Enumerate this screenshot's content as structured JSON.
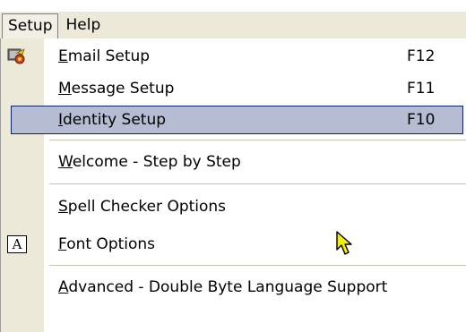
{
  "menubar": {
    "items": [
      {
        "label": "Setup"
      },
      {
        "label": "Help"
      }
    ]
  },
  "menu": {
    "items": [
      {
        "label": "Email Setup",
        "shortcut": "F12",
        "icon": "email-setup-icon"
      },
      {
        "label": "Message Setup",
        "shortcut": "F11"
      },
      {
        "label": "Identity Setup",
        "shortcut": "F10",
        "selected": true
      },
      {
        "label": "Welcome - Step by Step"
      },
      {
        "label": "Spell Checker Options"
      },
      {
        "label": "Font Options",
        "icon": "font-icon",
        "icon_text": "A"
      },
      {
        "label": "Advanced - Double Byte Language Support"
      }
    ]
  },
  "colors": {
    "menubar_bg": "#ece9d8",
    "highlight_bg": "#b6bdd2",
    "highlight_border": "#0a246a"
  }
}
